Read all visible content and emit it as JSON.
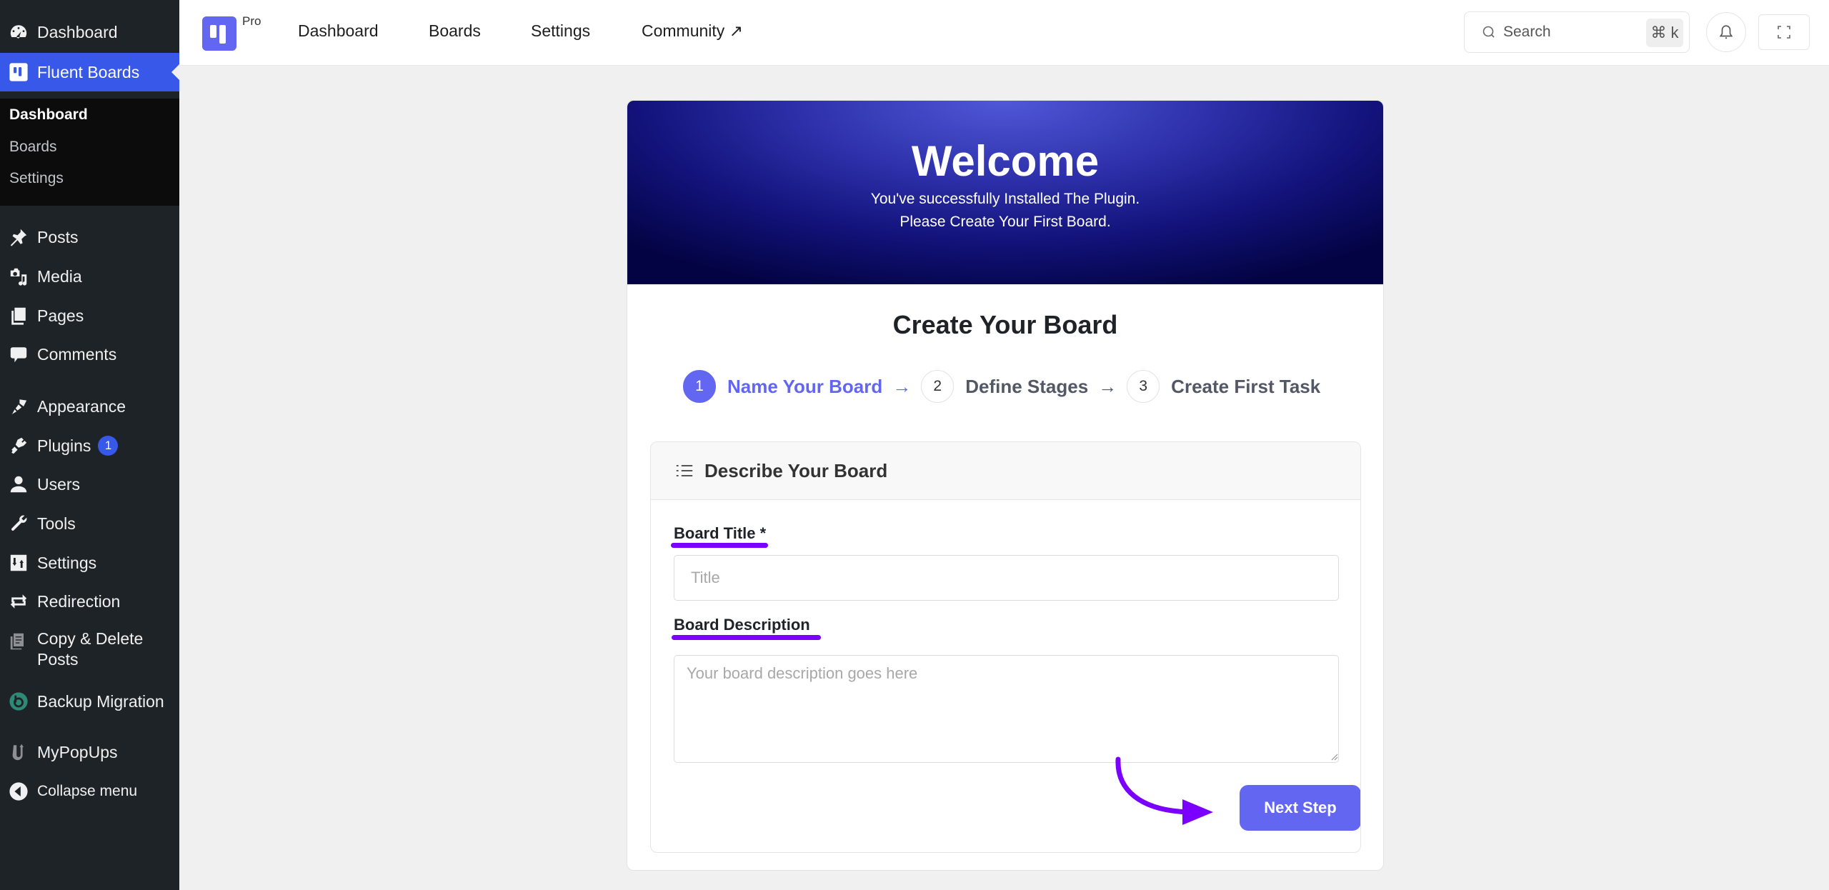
{
  "sidebar": {
    "items": [
      {
        "label": "Dashboard",
        "icon": "dashboard-icon"
      },
      {
        "label": "Fluent Boards",
        "icon": "fluent-boards-icon",
        "active": true
      },
      {
        "label": "Posts",
        "icon": "pin-icon"
      },
      {
        "label": "Media",
        "icon": "media-icon"
      },
      {
        "label": "Pages",
        "icon": "pages-icon"
      },
      {
        "label": "Comments",
        "icon": "comment-icon"
      },
      {
        "label": "Appearance",
        "icon": "paintbrush-icon"
      },
      {
        "label": "Plugins",
        "icon": "plugin-icon",
        "badge": "1"
      },
      {
        "label": "Users",
        "icon": "user-icon"
      },
      {
        "label": "Tools",
        "icon": "wrench-icon"
      },
      {
        "label": "Settings",
        "icon": "settings-icon"
      },
      {
        "label": "Redirection",
        "icon": "redirection-icon"
      },
      {
        "label": "Copy & Delete Posts",
        "label_line1": "Copy & Delete",
        "label_line2": "Posts",
        "icon": "copy-delete-icon"
      },
      {
        "label": "Backup Migration",
        "icon": "backup-icon"
      },
      {
        "label": "MyPopUps",
        "icon": "mypopups-icon"
      },
      {
        "label": "Collapse menu",
        "icon": "collapse-icon"
      }
    ],
    "submenu": [
      {
        "label": "Dashboard",
        "current": true
      },
      {
        "label": "Boards"
      },
      {
        "label": "Settings"
      }
    ]
  },
  "topbar": {
    "badge": "Pro",
    "nav": [
      {
        "label": "Dashboard"
      },
      {
        "label": "Boards"
      },
      {
        "label": "Settings"
      },
      {
        "label": "Community ↗"
      }
    ],
    "search": {
      "placeholder": "Search",
      "shortcut": "⌘ k"
    }
  },
  "hero": {
    "title": "Welcome",
    "line1": "You've successfully Installed The Plugin.",
    "line2": "Please Create Your First Board."
  },
  "create": {
    "title": "Create Your Board",
    "steps": [
      {
        "num": "1",
        "label": "Name Your Board",
        "active": true
      },
      {
        "num": "2",
        "label": "Define Stages"
      },
      {
        "num": "3",
        "label": "Create First Task"
      }
    ],
    "arrow": "→"
  },
  "form": {
    "panel_title": "Describe Your Board",
    "title_label": "Board Title *",
    "title_placeholder": "Title",
    "title_value": "",
    "desc_label": "Board Description",
    "desc_placeholder": "Your board description goes here",
    "desc_value": "",
    "next_label": "Next Step"
  },
  "colors": {
    "accent": "#6366f1",
    "wp_highlight": "#3858e9",
    "annotation": "#7a00ff",
    "sidebar_bg": "#1d2327"
  }
}
